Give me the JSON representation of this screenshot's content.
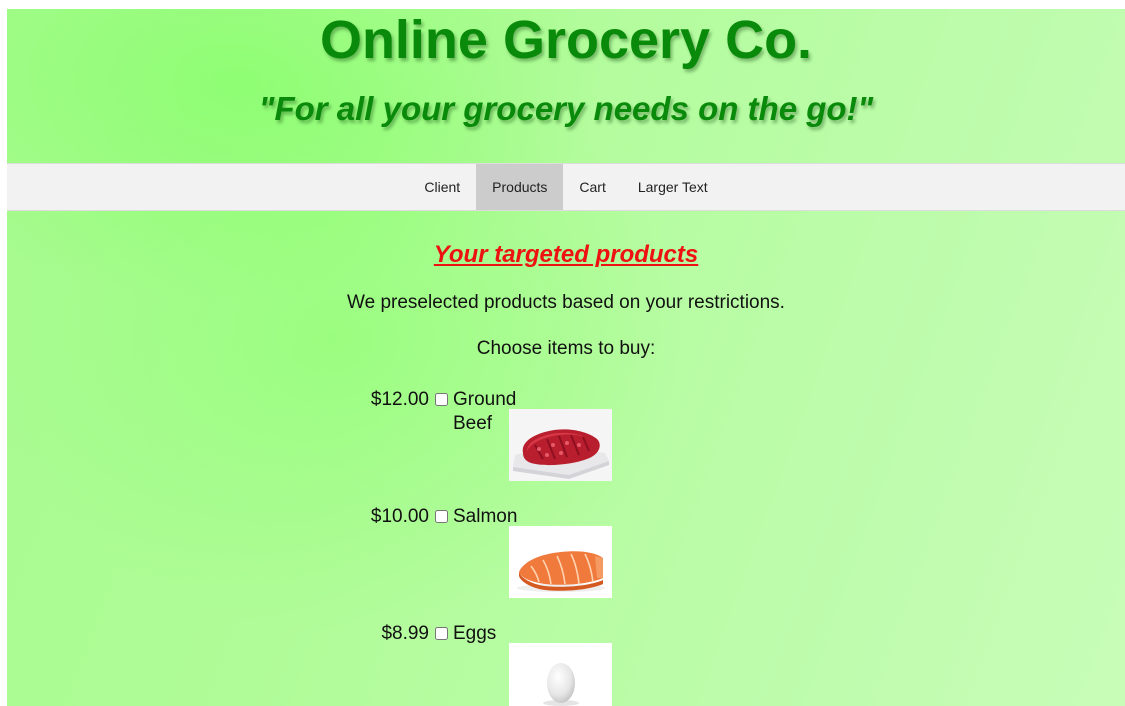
{
  "header": {
    "title": "Online Grocery Co.",
    "tagline": "\"For all your grocery needs on the go!\""
  },
  "nav": {
    "items": [
      {
        "label": "Client",
        "active": false
      },
      {
        "label": "Products",
        "active": true
      },
      {
        "label": "Cart",
        "active": false
      },
      {
        "label": "Larger Text",
        "active": false
      }
    ]
  },
  "main": {
    "section_title": "Your targeted products",
    "intro_text": "We preselected products based on your restrictions.",
    "choose_text": "Choose items to buy:"
  },
  "products": [
    {
      "name": "Ground Beef",
      "price": "$12.00",
      "checked": false,
      "image_icon": "ground-beef-image"
    },
    {
      "name": "Salmon",
      "price": "$10.00",
      "checked": false,
      "image_icon": "salmon-image"
    },
    {
      "name": "Eggs",
      "price": "$8.99",
      "checked": false,
      "image_icon": "egg-image"
    }
  ],
  "colors": {
    "title_green": "#0a8a0a",
    "section_red": "#ee1111",
    "nav_bg": "#f2f2f2",
    "nav_active": "#cccccc",
    "page_bg": "#b0fc98"
  }
}
